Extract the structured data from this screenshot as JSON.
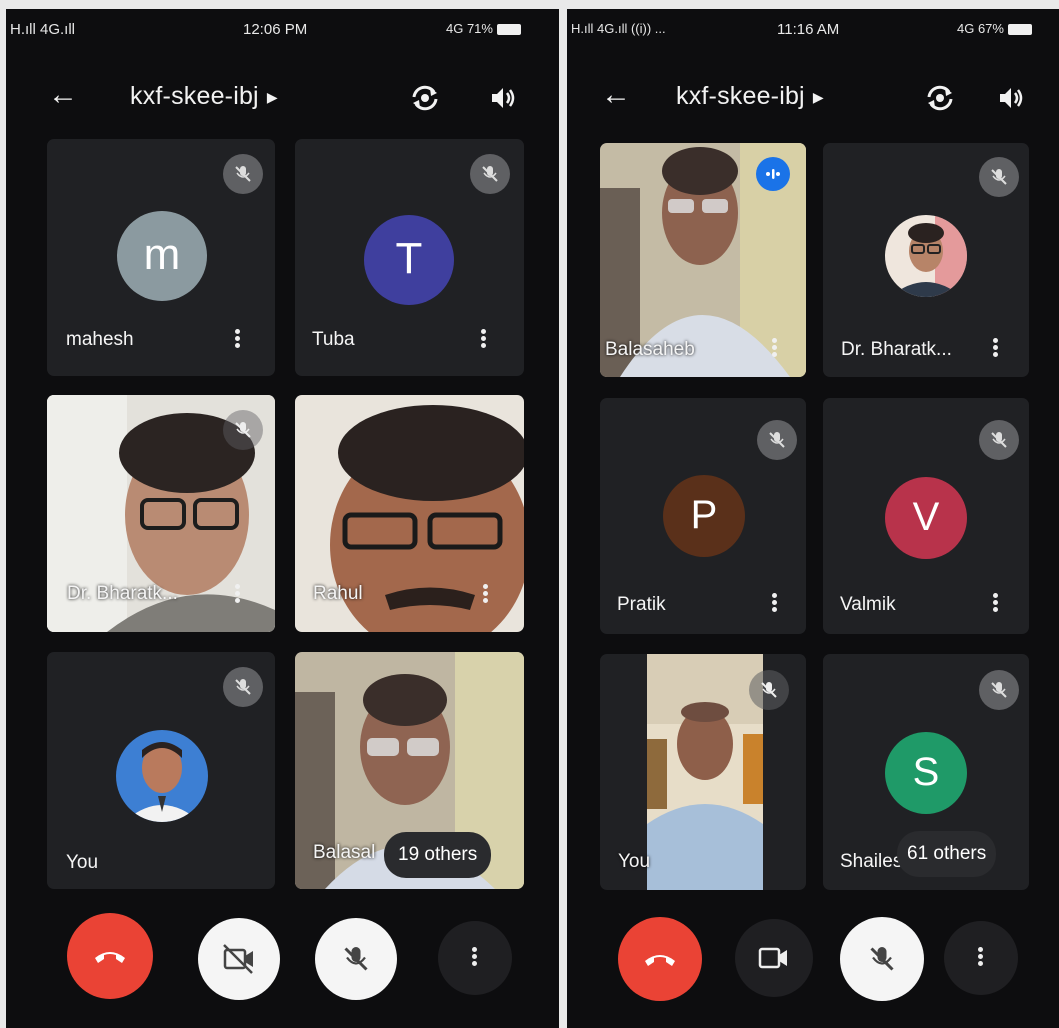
{
  "left": {
    "status": {
      "signal": "H.ıll 4G.ıll",
      "time": "12:06 PM",
      "battery": "4G 71%"
    },
    "meeting_code": "kxf-skee-ibj",
    "tiles": {
      "mahesh": {
        "initial": "m",
        "name": "mahesh",
        "avatar_color": "#8b9aa0"
      },
      "tuba": {
        "initial": "T",
        "name": "Tuba",
        "avatar_color": "#3f3f9e"
      },
      "bharat": {
        "name": "Dr. Bharatk..."
      },
      "rahul": {
        "name": "Rahul"
      },
      "you": {
        "name": "You"
      },
      "balasaheb": {
        "name": "Balasal"
      }
    },
    "others_label": "19 others"
  },
  "right": {
    "status": {
      "signal": "H.ıll 4G.ıll ((i)) ...",
      "time": "11:16 AM",
      "battery": "4G 67%"
    },
    "meeting_code": "kxf-skee-ibj",
    "tiles": {
      "balasaheb": {
        "name": "Balasaheb"
      },
      "bharat": {
        "name": "Dr. Bharatk..."
      },
      "pratik": {
        "initial": "P",
        "name": "Pratik",
        "avatar_color": "#5a301a"
      },
      "valmik": {
        "initial": "V",
        "name": "Valmik",
        "avatar_color": "#b8334b"
      },
      "you": {
        "name": "You"
      },
      "shailesh": {
        "initial": "S",
        "name": "Shailes",
        "avatar_color": "#1f9a68"
      }
    },
    "others_label": "61 others"
  },
  "icons": {
    "back": "arrow-left-icon",
    "switch_camera": "switch-camera-icon",
    "speaker": "speaker-icon",
    "mic_off": "mic-off-icon",
    "end_call": "end-call-icon",
    "camera": "camera-icon",
    "more": "more-vert-icon"
  },
  "colors": {
    "end_call": "#ea4335",
    "tile_bg": "#202124",
    "mute_badge": "#5f6063",
    "active_speaker": "#1a73e8"
  }
}
